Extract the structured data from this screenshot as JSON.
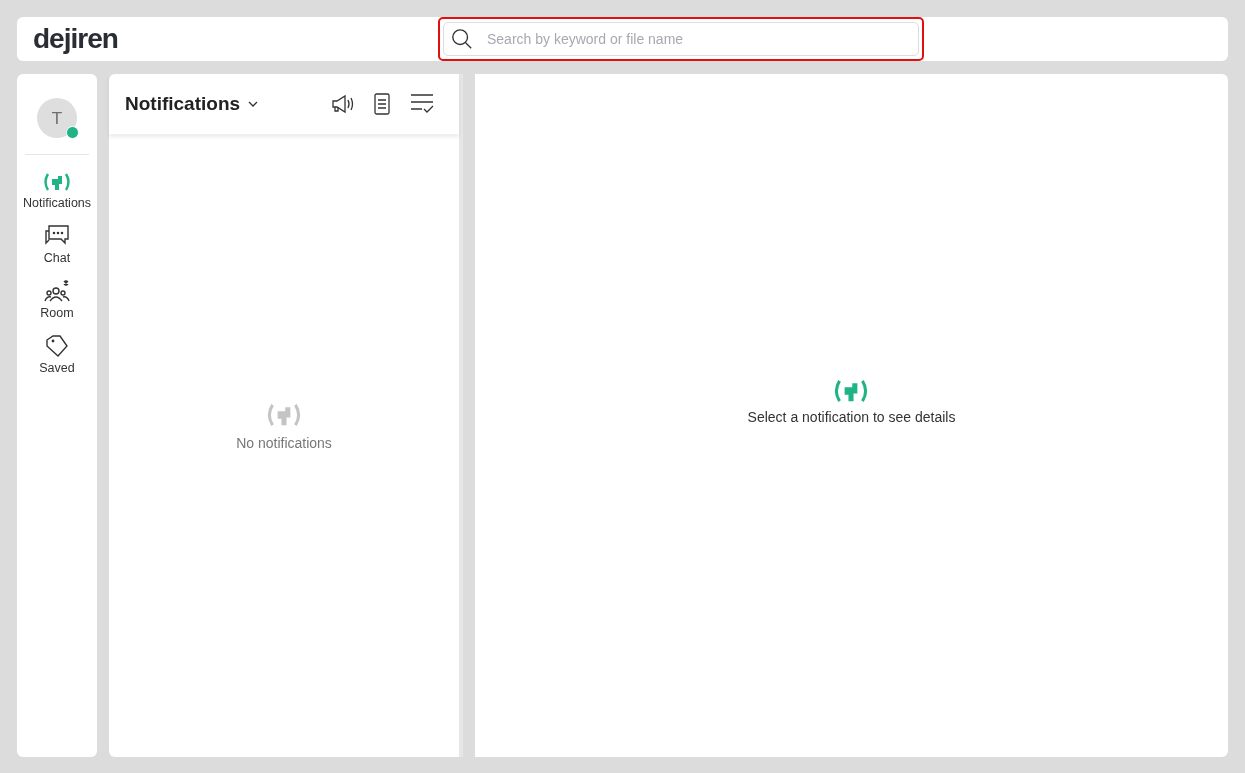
{
  "header": {
    "logo": "dejiren",
    "search": {
      "placeholder": "Search by keyword or file name",
      "highlighted": true
    }
  },
  "user": {
    "initial": "T",
    "online": true
  },
  "nav": [
    {
      "label": "Notifications",
      "selected": true
    },
    {
      "label": "Chat",
      "selected": false
    },
    {
      "label": "Room",
      "selected": false
    },
    {
      "label": "Saved",
      "selected": false
    }
  ],
  "list_panel": {
    "title": "Notifications",
    "empty_text": "No notifications"
  },
  "detail_panel": {
    "empty_text": "Select a notification to see details"
  }
}
